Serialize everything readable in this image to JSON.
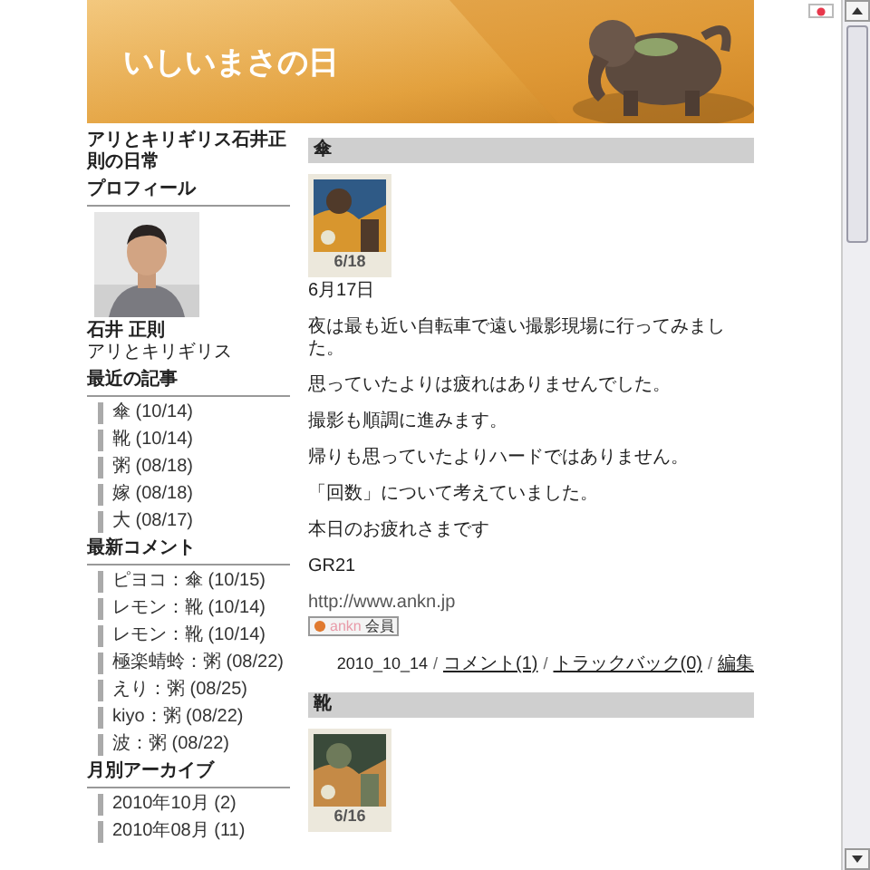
{
  "header": {
    "title": "いしいまさの日"
  },
  "blog_description": "アリとキリギリス石井正則の日常",
  "sidebar": [
    {
      "kind": "profile",
      "heading": "プロフィール",
      "name": "石井 正則",
      "subtitle": "アリとキリギリス"
    },
    {
      "kind": "list",
      "heading": "最近の記事",
      "items": [
        "傘 (10/14)",
        "靴 (10/14)",
        "粥 (08/18)",
        "嫁 (08/18)",
        "大 (08/17)"
      ]
    },
    {
      "kind": "list",
      "heading": "最新コメント",
      "items": [
        "ピヨコ：傘 (10/15)",
        "レモン：靴 (10/14)",
        "レモン：靴 (10/14)",
        "極楽蜻蛉：粥 (08/22)",
        "えり：粥 (08/25)",
        "kiyo：粥 (08/22)",
        "波：粥 (08/22)"
      ]
    },
    {
      "kind": "list",
      "heading": "月別アーカイブ",
      "items": [
        "2010年10月 (2)",
        "2010年08月 (11)"
      ]
    }
  ],
  "posts": [
    {
      "title": "傘",
      "photo_caption": "6/18",
      "date_line": "6月17日",
      "paragraphs": [
        "夜は最も近い自転車で遠い撮影現場に行ってみました。",
        "思っていたよりは疲れはありませんでした。",
        "撮影も順調に進みます。",
        "帰りも思っていたよりハードではありません。",
        "「回数」について考えていました。",
        "本日のお疲れさまです",
        "GR21"
      ],
      "link": "http://www.ankn.jp",
      "badge": {
        "brand": "ankn",
        "label": "会員"
      },
      "footer": [
        {
          "kind": "text",
          "text": "2010_10_14"
        },
        {
          "kind": "sep",
          "text": "/"
        },
        {
          "kind": "link",
          "text": "コメント(1)"
        },
        {
          "kind": "sep",
          "text": "/"
        },
        {
          "kind": "link",
          "text": "トラックバック(0)"
        },
        {
          "kind": "sep",
          "text": "/"
        },
        {
          "kind": "link",
          "text": "編集"
        }
      ]
    },
    {
      "title": "靴",
      "photo_caption": "6/16"
    }
  ]
}
